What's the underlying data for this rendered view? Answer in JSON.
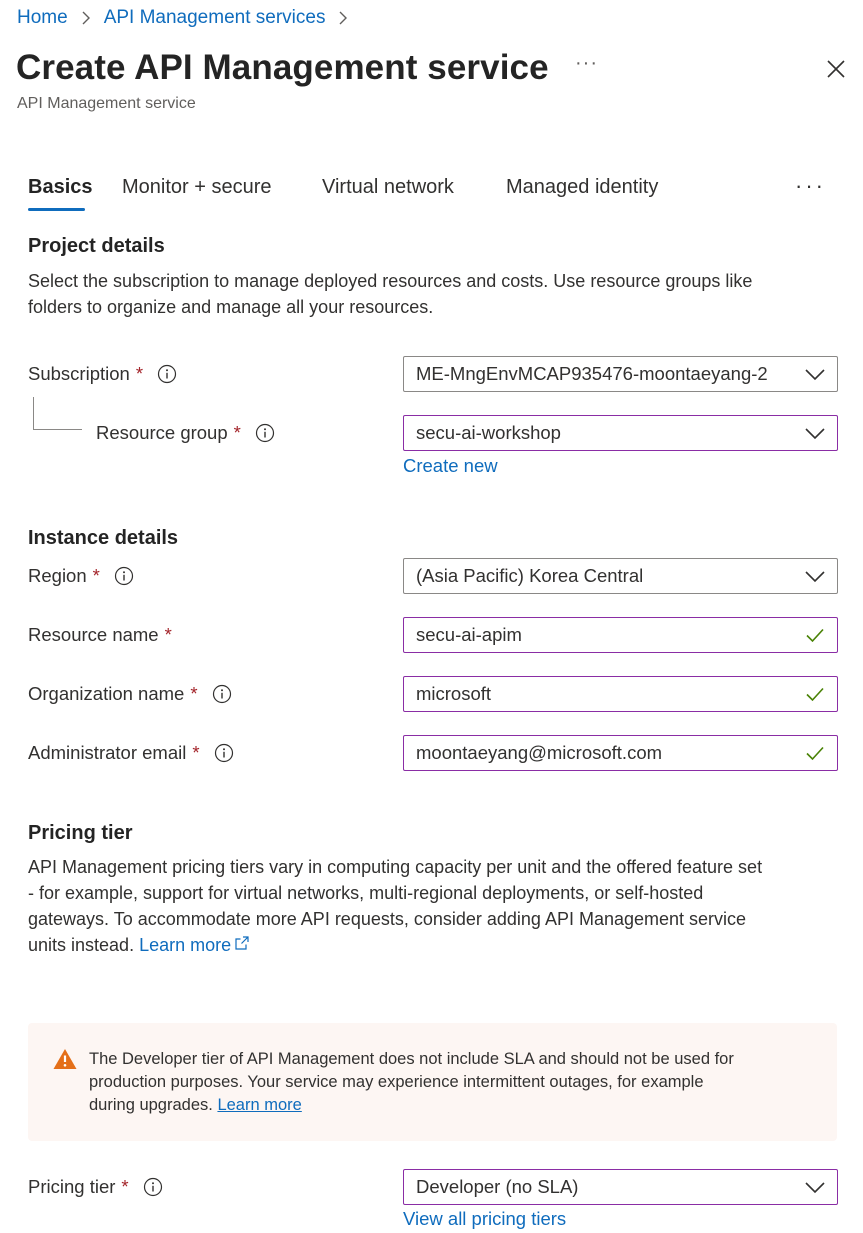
{
  "breadcrumb": {
    "home": "Home",
    "services": "API Management services"
  },
  "page": {
    "title": "Create API Management service",
    "subtitle": "API Management service",
    "more": "···"
  },
  "tabs": [
    {
      "label": "Basics",
      "active": true
    },
    {
      "label": "Monitor + secure"
    },
    {
      "label": "Virtual network"
    },
    {
      "label": "Managed identity"
    }
  ],
  "tabs_more": "···",
  "project": {
    "heading": "Project details",
    "description_line1": "Select the subscription to manage deployed resources and costs. Use resource groups like",
    "description_line2": "folders to organize and manage all your resources.",
    "subscription_label": "Subscription",
    "subscription_value": "ME-MngEnvMCAP935476-moontaeyang-2",
    "resource_group_label": "Resource group",
    "resource_group_value": "secu-ai-workshop",
    "create_new": "Create new"
  },
  "instance": {
    "heading": "Instance details",
    "region_label": "Region",
    "region_value": "(Asia Pacific) Korea Central",
    "resource_name_label": "Resource name",
    "resource_name_value": "secu-ai-apim",
    "org_name_label": "Organization name",
    "org_name_value": "microsoft",
    "admin_email_label": "Administrator email",
    "admin_email_value": "moontaeyang@microsoft.com"
  },
  "pricing": {
    "heading": "Pricing tier",
    "line1": "API Management pricing tiers vary in computing capacity per unit and the offered feature set",
    "line2": "- for example, support for virtual networks, multi-regional deployments, or self-hosted",
    "line3": "gateways. To accommodate more API requests, consider adding API Management service",
    "line4": "units instead.",
    "learn_more": "Learn more",
    "warning_line1": "The Developer tier of API Management does not include SLA and should not be used for",
    "warning_line2": "production purposes. Your service may experience intermittent outages, for example",
    "warning_line3": "during upgrades.",
    "warning_learn_more": "Learn more",
    "tier_label": "Pricing tier",
    "tier_value": "Developer (no SLA)",
    "view_all": "View all pricing tiers"
  },
  "required_mark": "*",
  "colors": {
    "link": "#0f6cbd",
    "required": "#a4262c",
    "focus_border": "#8a2da5",
    "valid_check": "#498205",
    "warning": "#e46f19",
    "warning_bg": "#fdf6f3"
  }
}
